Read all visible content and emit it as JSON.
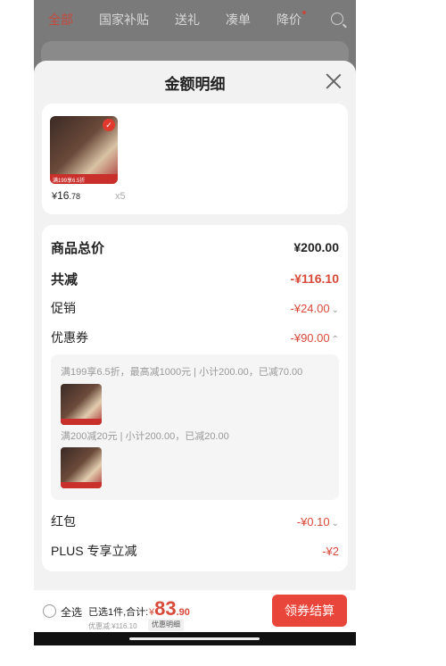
{
  "top_tabs": [
    {
      "label": "全部",
      "active": true
    },
    {
      "label": "国家补贴",
      "active": false
    },
    {
      "label": "送礼",
      "active": false
    },
    {
      "label": "凑单",
      "active": false
    },
    {
      "label": "降价",
      "active": false
    }
  ],
  "sheet": {
    "title": "金额明细"
  },
  "items": {
    "thumb_badge": "满199享6.5折",
    "price_currency": "¥",
    "price_int": "16",
    "price_dec": ".78",
    "quantity": "x5"
  },
  "detail": {
    "total_label": "商品总价",
    "total_value": "¥200.00",
    "reduce_label": "共减",
    "reduce_value": "-¥116.10",
    "promo_label": "促销",
    "promo_value": "-¥24.00",
    "coupon_label": "优惠券",
    "coupon_value": "-¥90.00",
    "coupon_rule_1": "满199享6.5折，最高减1000元 | 小计200.00，已减70.00",
    "coupon_rule_2": "满200减20元 | 小计200.00，已减20.00",
    "redpacket_label": "红包",
    "redpacket_value": "-¥0.10",
    "plus_label": "PLUS 专享立减",
    "plus_value": "-¥2"
  },
  "bottom": {
    "select_all": "全选",
    "summary": "已选1件,合计:",
    "total_currency": "¥",
    "total_int": "83",
    "total_dec": ".90",
    "saved": "优惠减:¥116.10",
    "detail_chip": "优惠明细",
    "checkout": "领券结算"
  },
  "colors": {
    "accent": "#e8463a",
    "price_red": "#d84a3a"
  }
}
